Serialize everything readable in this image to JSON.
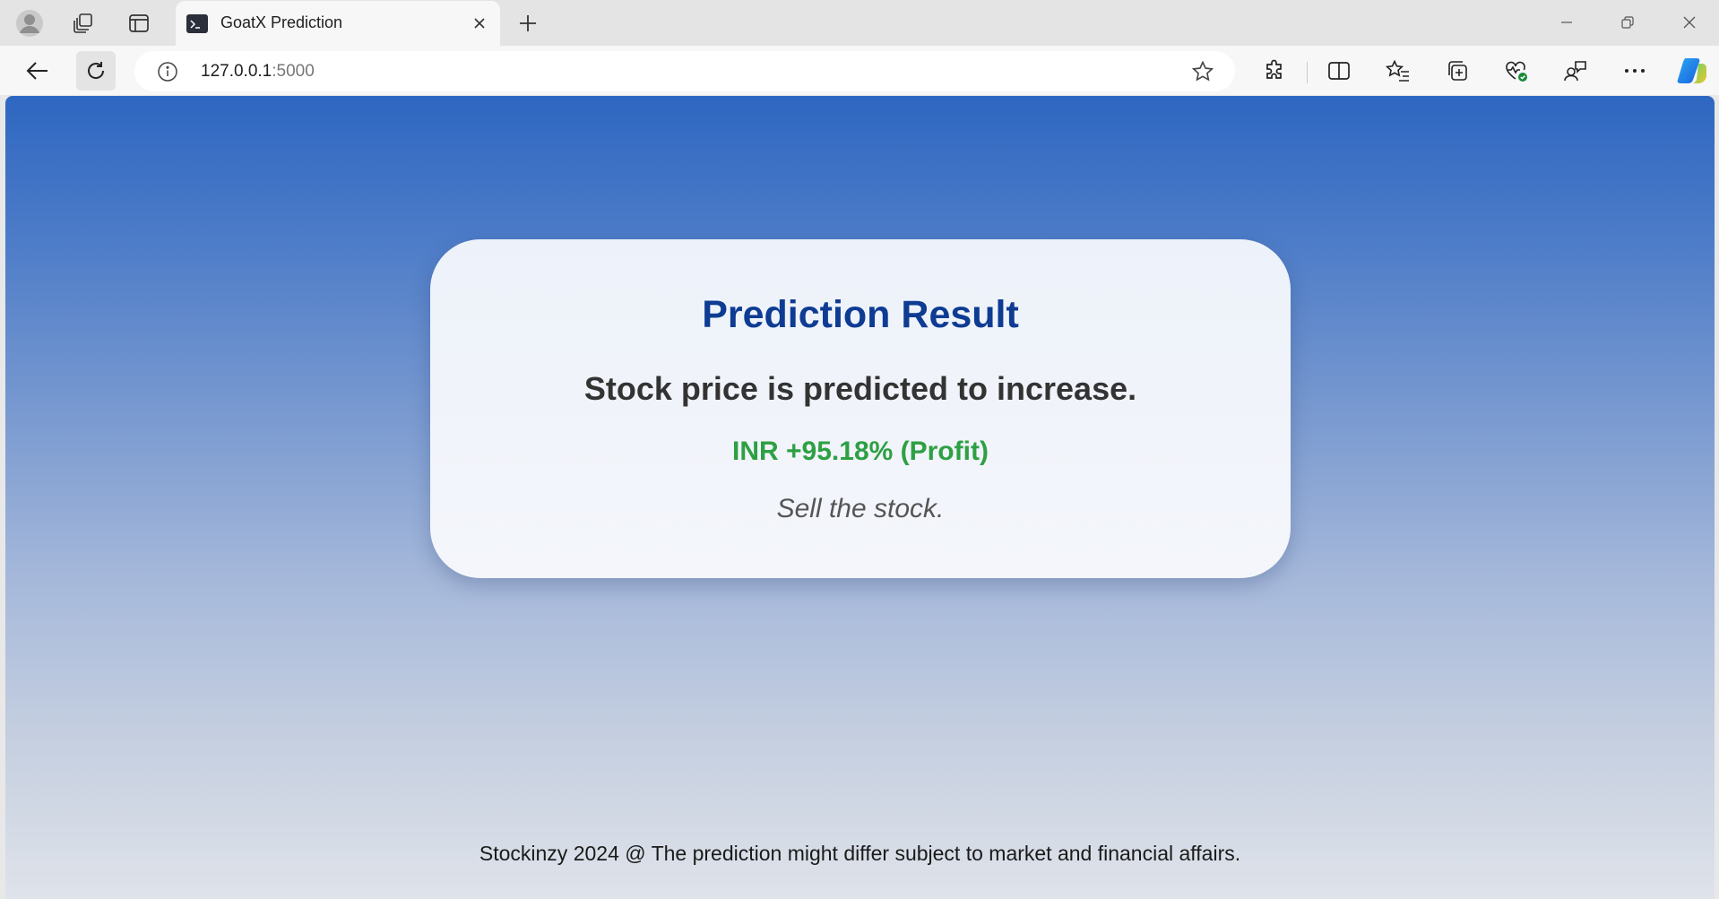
{
  "browser": {
    "tab": {
      "title": "GoatX Prediction"
    },
    "address": {
      "host": "127.0.0.1",
      "port": ":5000"
    }
  },
  "page": {
    "card": {
      "title": "Prediction Result",
      "statement": "Stock price is predicted to increase.",
      "change": "INR +95.18% (Profit)",
      "advice": "Sell the stock."
    },
    "footer": "Stockinzy 2024 @ The prediction might differ subject to market and financial affairs."
  },
  "colors": {
    "title": "#0e3c93",
    "profit": "#2ea043",
    "background_top": "#2e67c1",
    "background_bottom": "#dfe3ea"
  }
}
